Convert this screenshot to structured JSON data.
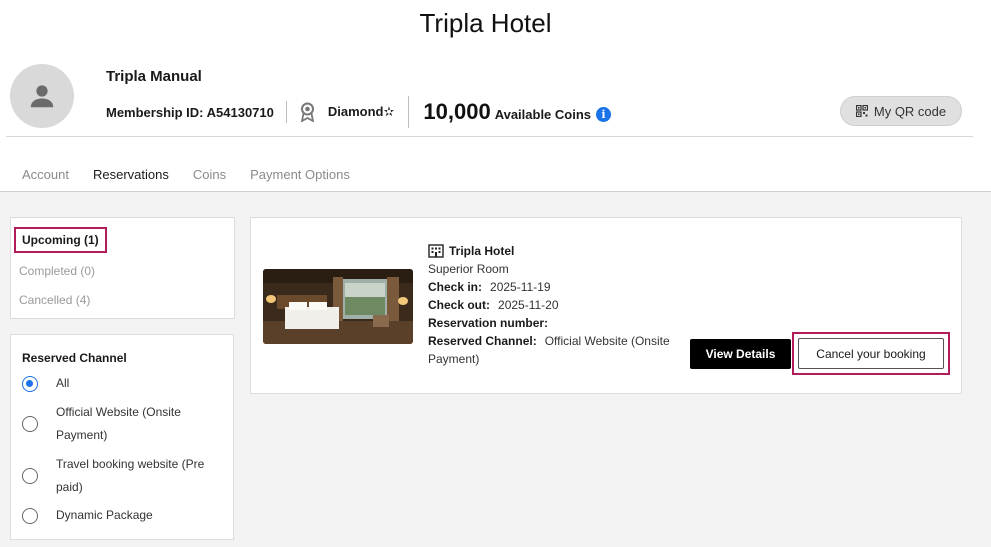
{
  "header": {
    "title": "Tripla Hotel"
  },
  "profile": {
    "name": "Tripla Manual",
    "membership_id": "Membership ID: A54130710",
    "tier": "Diamond✫",
    "coins_value": "10,000",
    "coins_label": "Available Coins",
    "qr_label": "My QR code"
  },
  "tabs": [
    {
      "label": "Account"
    },
    {
      "label": "Reservations"
    },
    {
      "label": "Coins"
    },
    {
      "label": "Payment Options"
    }
  ],
  "status_filters": {
    "upcoming": "Upcoming (1)",
    "completed": "Completed (0)",
    "cancelled": "Cancelled (4)"
  },
  "channel_filter": {
    "title": "Reserved Channel",
    "options": [
      {
        "label": "All",
        "checked": true
      },
      {
        "label": "Official Website (Onsite Payment)",
        "checked": false
      },
      {
        "label": "Travel booking website (Pre paid)",
        "checked": false
      },
      {
        "label": "Dynamic Package",
        "checked": false
      }
    ]
  },
  "booking": {
    "hotel_name": "Tripla Hotel",
    "room_type": "Superior Room",
    "check_in_label": "Check in:",
    "check_in_value": "2025-11-19",
    "check_out_label": "Check out:",
    "check_out_value": "2025-11-20",
    "reservation_number_label": "Reservation number:",
    "reservation_number_value": "",
    "channel_label": "Reserved Channel:",
    "channel_value": "Official Website (Onsite Payment)",
    "view_details_label": "View Details",
    "cancel_label": "Cancel your booking"
  },
  "colors": {
    "highlight": "#b01d5a",
    "accent": "#1a73e8"
  }
}
